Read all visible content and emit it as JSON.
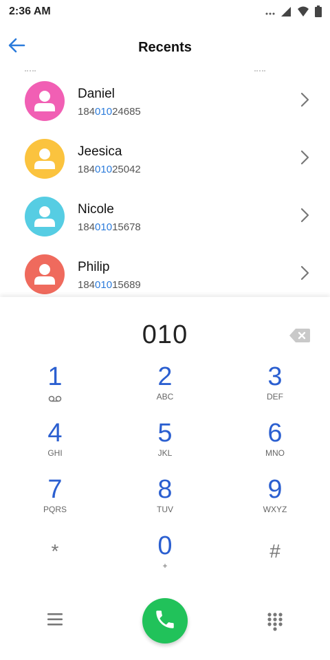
{
  "status_bar": {
    "time": "2:36 AM",
    "icons": [
      "more-dots-icon",
      "signal-icon",
      "wifi-icon",
      "battery-icon"
    ]
  },
  "header": {
    "title": "Recents",
    "back_icon": "arrow-left-icon"
  },
  "contacts": [
    {
      "name": "Daniel",
      "number_prefix": "184",
      "number_match": "010",
      "number_suffix": "24685",
      "avatar_color": "#f15fb4"
    },
    {
      "name": "Jeesica",
      "number_prefix": "184",
      "number_match": "010",
      "number_suffix": "25042",
      "avatar_color": "#fbc33e"
    },
    {
      "name": "Nicole",
      "number_prefix": "184",
      "number_match": "010",
      "number_suffix": "15678",
      "avatar_color": "#56cde3"
    },
    {
      "name": "Philip",
      "number_prefix": "184",
      "number_match": "010",
      "number_suffix": "15689",
      "avatar_color": "#ef6a5d"
    }
  ],
  "dialer": {
    "display": "010",
    "keys": [
      {
        "digit": "1",
        "letters": ""
      },
      {
        "digit": "2",
        "letters": "ABC"
      },
      {
        "digit": "3",
        "letters": "DEF"
      },
      {
        "digit": "4",
        "letters": "GHI"
      },
      {
        "digit": "5",
        "letters": "JKL"
      },
      {
        "digit": "6",
        "letters": "MNO"
      },
      {
        "digit": "7",
        "letters": "PQRS"
      },
      {
        "digit": "8",
        "letters": "TUV"
      },
      {
        "digit": "9",
        "letters": "WXYZ"
      },
      {
        "digit": "*",
        "letters": ""
      },
      {
        "digit": "0",
        "letters": "+"
      },
      {
        "digit": "#",
        "letters": ""
      }
    ]
  },
  "colors": {
    "accent": "#2b5fd0",
    "match_highlight": "#2b7bdb",
    "call_green": "#21c25a"
  }
}
